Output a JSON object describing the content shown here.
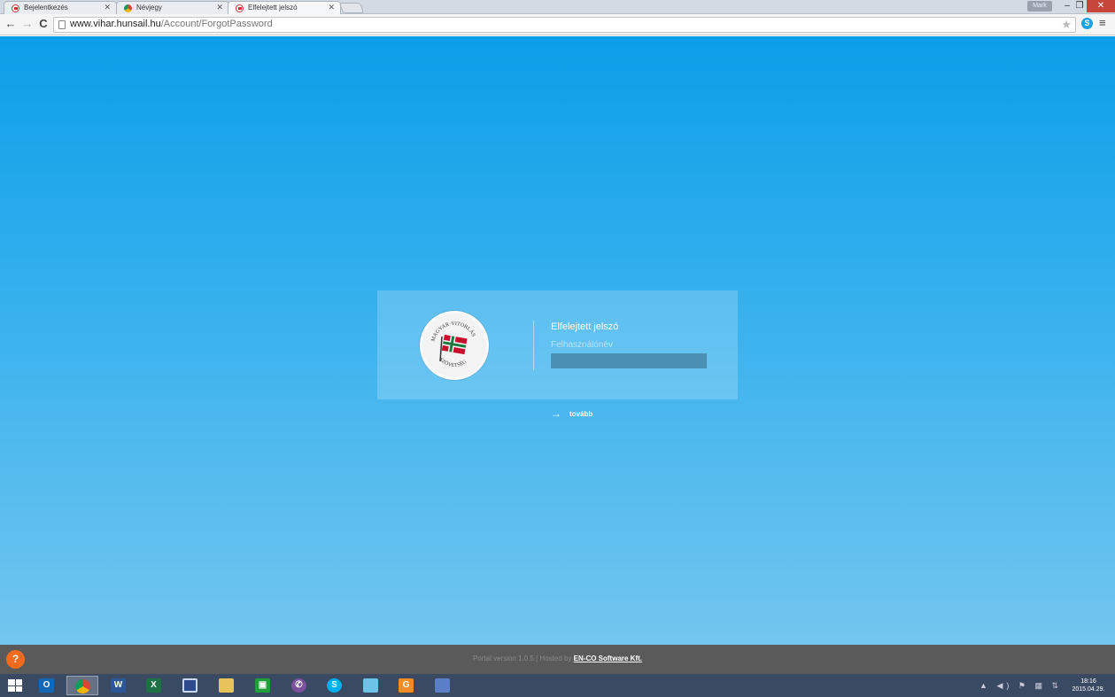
{
  "browser": {
    "tabs": [
      {
        "title": "Bejelentkezés",
        "favicon": "site-flag-icon"
      },
      {
        "title": "Névjegy",
        "favicon": "google-contacts-icon"
      },
      {
        "title": "Elfelejtett jelszó",
        "favicon": "site-flag-icon"
      }
    ],
    "user_label": "Mark",
    "url_host": "www.vihar.hunsail.hu",
    "url_path": "/Account/ForgotPassword"
  },
  "form": {
    "title": "Elfelejtett jelszó",
    "username_label": "Felhasználónév",
    "username_value": "",
    "next_label": "tovább"
  },
  "logo": {
    "top_text": "MAGYAR",
    "right_text": "VITORLÁS",
    "bottom_text": "SZÖVETSÉG"
  },
  "footer": {
    "version_text": "Portal version 1.0.5 | Hosted by ",
    "host_link": "EN-CO Software Kft.",
    "help_symbol": "?"
  },
  "taskbar": {
    "apps": [
      "outlook-icon",
      "chrome-icon",
      "word-icon",
      "excel-icon",
      "save-floppy-icon",
      "file-explorer-icon",
      "store-icon",
      "viber-icon",
      "skype-icon",
      "photos-icon",
      "pdf-creator-icon",
      "scan-icon"
    ],
    "time": "18:16",
    "date": "2015.04.29."
  },
  "colors": {
    "accent": "#0b9ee8",
    "footer": "#5a5a5a",
    "help": "#f26b1d"
  }
}
